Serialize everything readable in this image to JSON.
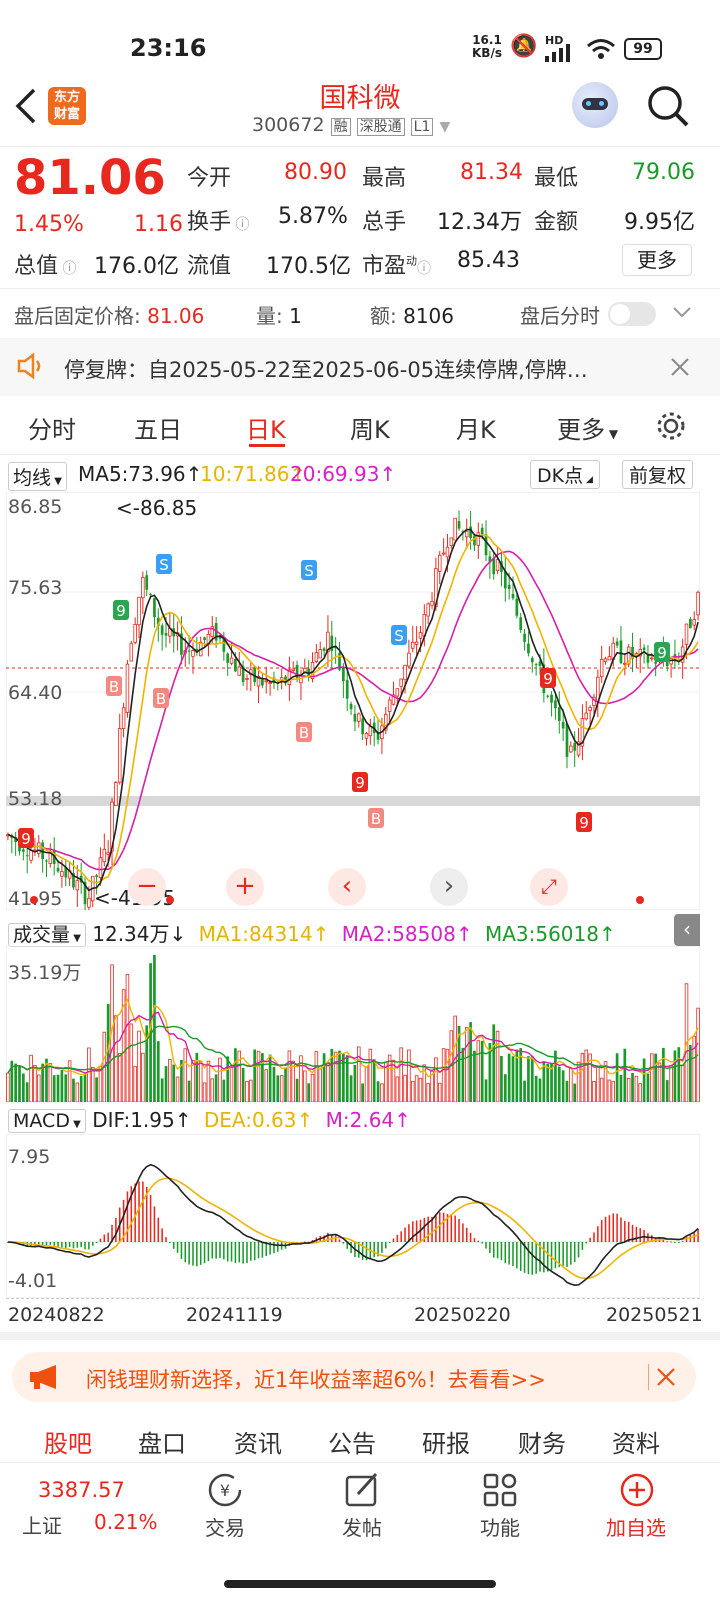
{
  "status_bar": {
    "time": "23:16",
    "net_speed_top": "16.1",
    "net_speed_bottom": "KB/s",
    "hd": "HD",
    "battery": "99"
  },
  "header": {
    "app_logo_line1": "东方",
    "app_logo_line2": "财富",
    "title": "国科微",
    "code": "300672",
    "tag1": "融",
    "tag2": "深股通",
    "tag3": "L1"
  },
  "quote": {
    "price": "81.06",
    "change_pct": "1.45%",
    "change": "1.16",
    "open_label": "今开",
    "open": "80.90",
    "high_label": "最高",
    "high": "81.34",
    "low_label": "最低",
    "low": "79.06",
    "turnover_label": "换手",
    "turnover": "5.87%",
    "volume_label": "总手",
    "volume": "12.34万",
    "amount_label": "金额",
    "amount": "9.95亿",
    "mktcap_label": "总值",
    "mktcap": "176.0亿",
    "float_label": "流值",
    "float": "170.5亿",
    "pe_label": "市盈",
    "pe_sup": "动",
    "pe": "85.43",
    "more": "更多"
  },
  "after_hours": {
    "fixed_label": "盘后固定价格:",
    "fixed": "81.06",
    "qty_label": "量:",
    "qty": "1",
    "amt_label": "额:",
    "amt": "8106",
    "time_label": "盘后分时"
  },
  "notice": {
    "text": "停复牌：自2025-05-22至2025-06-05连续停牌,停牌…"
  },
  "period_tabs": [
    "分时",
    "五日",
    "日K",
    "周K",
    "月K",
    "更多"
  ],
  "active_tab": "日K",
  "ma_line": {
    "selector": "均线",
    "ma5": "MA5:73.96",
    "ma10": "10:71.86",
    "ma20": "20:69.93",
    "dk": "DK点",
    "adjust": "前复权"
  },
  "price_axis": [
    "86.85",
    "75.63",
    "64.40",
    "53.18",
    "41.95"
  ],
  "price_marks": {
    "max": "<-86.85",
    "min": "<-41.95"
  },
  "vol_line": {
    "selector": "成交量",
    "vol": "12.34万",
    "ma1": "MA1:84314",
    "ma2": "MA2:58508",
    "ma3": "MA3:56018",
    "axis_top": "35.19万"
  },
  "macd_line": {
    "selector": "MACD",
    "dif": "DIF:1.95",
    "dea": "DEA:0.63",
    "m": "M:2.64",
    "axis_top": "7.95",
    "axis_bottom": "-4.01"
  },
  "dates": [
    "20240822",
    "20241119",
    "20250220",
    "20250521"
  ],
  "ad_banner": {
    "text": "闲钱理财新选择，近1年收益率超6%！去看看>>"
  },
  "bottom_tabs": [
    "股吧",
    "盘口",
    "资讯",
    "公告",
    "研报",
    "财务",
    "资料"
  ],
  "nav": {
    "index_value": "3387.57",
    "index_name": "上证",
    "index_pct": "0.21%",
    "trade": "交易",
    "post": "发帖",
    "func": "功能",
    "add": "加自选"
  },
  "colors": {
    "up": "#e8281e",
    "down": "#1a9a2a",
    "ma5": "#222222",
    "ma10": "#f0b400",
    "ma20": "#d620a8",
    "accent": "#f0821e"
  }
}
